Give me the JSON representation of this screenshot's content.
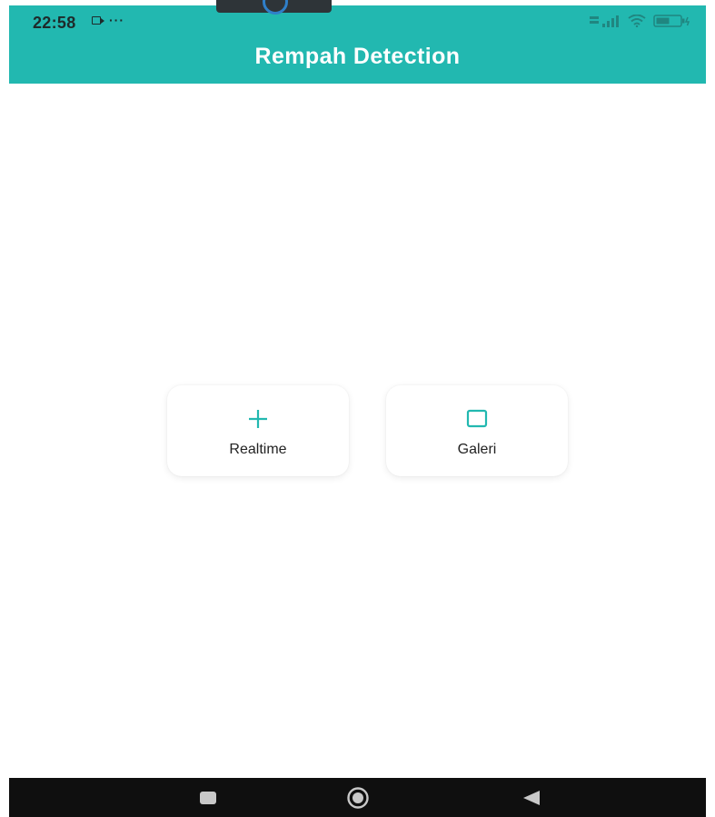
{
  "status_bar": {
    "time": "22:58",
    "more_indicator": "···",
    "icons": [
      "video-icon",
      "more-icon",
      "signal-icon",
      "wifi-icon",
      "battery-icon"
    ]
  },
  "app_bar": {
    "title": "Rempah Detection"
  },
  "actions": [
    {
      "label": "Realtime",
      "icon": "plus-icon"
    },
    {
      "label": "Galeri",
      "icon": "square-icon"
    }
  ],
  "navigation": {
    "buttons": [
      "recent-apps-icon",
      "home-icon",
      "back-icon"
    ]
  },
  "colors": {
    "primary": "#22b8b0",
    "nav_bar": "#0f0f0f",
    "text": "#222222",
    "card_background": "#ffffff"
  }
}
